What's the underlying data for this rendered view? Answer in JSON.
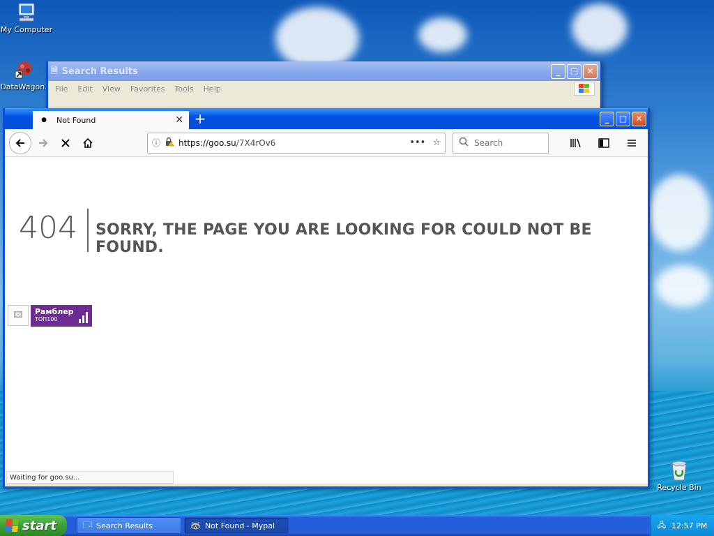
{
  "desktop": {
    "icons": [
      {
        "label": "My Computer",
        "icon": "computer-icon"
      },
      {
        "label": "DataWagon.",
        "icon": "datawagon-icon"
      },
      {
        "label": "Recycle Bin",
        "icon": "recycle-bin-icon"
      }
    ]
  },
  "bg_window": {
    "title": "Search Results",
    "menu": [
      "File",
      "Edit",
      "View",
      "Favorites",
      "Tools",
      "Help"
    ]
  },
  "browser": {
    "tab_title": "Not Found",
    "new_tab_symbol": "+",
    "url_host": "https://goo.su",
    "url_path": "/7X4rOv6",
    "search_placeholder": "Search",
    "page": {
      "code": "404",
      "message": "SORRY, THE PAGE YOU ARE LOOKING FOR COULD NOT BE FOUND."
    },
    "rambler": {
      "line1": "Рамблер",
      "line2": "ТОП100"
    },
    "status": "Waiting for goo.su..."
  },
  "taskbar": {
    "start_label": "start",
    "tasks": [
      {
        "label": "Search Results",
        "active": false
      },
      {
        "label": "Not Found - Mypal",
        "active": true
      }
    ],
    "clock": "12:57 PM"
  },
  "colors": {
    "xp_title_blue": "#0053e3",
    "start_green": "#3c9f36",
    "rambler_purple": "#6c2c91",
    "firefox_accent": "#0a84ff"
  }
}
